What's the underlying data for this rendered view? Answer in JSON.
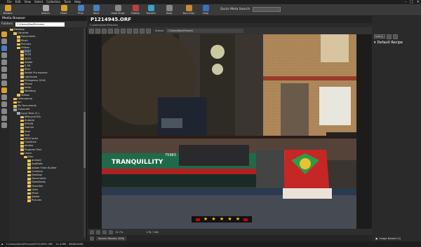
{
  "menubar": {
    "items": [
      "File",
      "Edit",
      "View",
      "Select",
      "Collection",
      "Tools",
      "Help"
    ]
  },
  "toolbar": {
    "buttons": [
      {
        "label": "Browse",
        "color": "#d9a12a"
      },
      {
        "label": "Search",
        "color": "#aaaaaa"
      },
      {
        "label": "Paste",
        "color": "#d9a12a"
      },
      {
        "label": "Prev",
        "color": "#4a7fc0"
      },
      {
        "label": "Next",
        "color": "#4a7fc0"
      },
      {
        "label": "Slide Show",
        "color": "#888888"
      },
      {
        "label": "Publish",
        "color": "#c04040"
      },
      {
        "label": "Transfer",
        "color": "#3aa0d0"
      },
      {
        "label": "Tools",
        "color": "#888888"
      },
      {
        "label": "Burn Disc",
        "color": "#cc8a2a"
      },
      {
        "label": "Help",
        "color": "#3a70c0"
      }
    ],
    "quick_search_label": "Quick Meta Search"
  },
  "left_panel": {
    "title": "Media Browser",
    "tab_label": "Folders",
    "path": "C:\\Users\\Dan\\Pictures\\",
    "tree": [
      {
        "label": "Desktop",
        "indent": 0,
        "drive": false
      },
      {
        "label": "Libraries",
        "indent": 1,
        "drive": false
      },
      {
        "label": "Documents",
        "indent": 2,
        "drive": false
      },
      {
        "label": "Music",
        "indent": 2,
        "drive": false
      },
      {
        "label": "Pictures",
        "indent": 2,
        "drive": false
      },
      {
        "label": "Videos",
        "indent": 2,
        "drive": false
      },
      {
        "label": "2017",
        "indent": 3,
        "drive": false,
        "selected": true
      },
      {
        "label": "2016",
        "indent": 3,
        "drive": false
      },
      {
        "label": "2015",
        "indent": 3,
        "drive": false
      },
      {
        "label": "Adobe",
        "indent": 3,
        "drive": false
      },
      {
        "label": "E-M1",
        "indent": 3,
        "drive": false
      },
      {
        "label": "flickr",
        "indent": 3,
        "drive": false
      },
      {
        "label": "Kodak Pro exports",
        "indent": 3,
        "drive": false
      },
      {
        "label": "Lightroom",
        "indent": 3,
        "drive": false
      },
      {
        "label": "Philippines 2016",
        "indent": 3,
        "drive": false
      },
      {
        "label": "Phone",
        "indent": 3,
        "drive": false
      },
      {
        "label": "temp",
        "indent": 3,
        "drive": false
      },
      {
        "label": "Wedding",
        "indent": 3,
        "drive": false
      },
      {
        "label": "Videos",
        "indent": 2,
        "drive": false
      },
      {
        "label": "Homegroup",
        "indent": 1,
        "drive": false
      },
      {
        "label": "Ian",
        "indent": 1,
        "drive": false
      },
      {
        "label": "My Documents",
        "indent": 1,
        "drive": false
      },
      {
        "label": "Computer",
        "indent": 1,
        "drive": true
      },
      {
        "label": "Local Disk (C:)",
        "indent": 2,
        "drive": true
      },
      {
        "label": "$Recycle.Bin",
        "indent": 3,
        "drive": false
      },
      {
        "label": "Android",
        "indent": 3,
        "drive": false
      },
      {
        "label": "EPSON",
        "indent": 3,
        "drive": false
      },
      {
        "label": "Garmin",
        "indent": 3,
        "drive": false
      },
      {
        "label": "Intel",
        "indent": 3,
        "drive": false
      },
      {
        "label": "logs",
        "indent": 3,
        "drive": false
      },
      {
        "label": "MSOCache",
        "indent": 3,
        "drive": false
      },
      {
        "label": "OneDrive",
        "indent": 3,
        "drive": false
      },
      {
        "label": "photos",
        "indent": 3,
        "drive": false
      },
      {
        "label": "Program Files",
        "indent": 3,
        "drive": false
      },
      {
        "label": "Users",
        "indent": 3,
        "drive": false
      },
      {
        "label": "Dan",
        "indent": 4,
        "drive": false
      },
      {
        "label": "android",
        "indent": 5,
        "drive": false
      },
      {
        "label": "AppData",
        "indent": 5,
        "drive": false
      },
      {
        "label": "Adobe Flash Builder",
        "indent": 5,
        "drive": false
      },
      {
        "label": "Contacts",
        "indent": 5,
        "drive": false
      },
      {
        "label": "Desktop",
        "indent": 5,
        "drive": false
      },
      {
        "label": "Documents",
        "indent": 5,
        "drive": false
      },
      {
        "label": "Downloads",
        "indent": 5,
        "drive": false
      },
      {
        "label": "Favorites",
        "indent": 5,
        "drive": false
      },
      {
        "label": "Links",
        "indent": 5,
        "drive": false
      },
      {
        "label": "Music",
        "indent": 5,
        "drive": false
      },
      {
        "label": "Adobe",
        "indent": 5,
        "drive": false
      },
      {
        "label": "Pictures",
        "indent": 5,
        "drive": false
      }
    ]
  },
  "viewer": {
    "title": "P1214945.ORF",
    "path": "C:\\Users\\Dan\\Pictures\\",
    "history_label": "history",
    "history_path": "C:\\Users\\Dan\\Pictures\\",
    "zoom": "13.7%",
    "count": "178 / 348",
    "rating_stars": 5,
    "search_results_label": "Search Results (346)",
    "boat_name": "TRANQUILLITY",
    "boat_number": "75983"
  },
  "right_panel": {
    "select_label": "Setting",
    "recipe_label": "Default Recipe",
    "bottom_label": "Image Basket (0)"
  },
  "statusbar": {
    "path": "C:\\Users\\Dan\\Pictures\\P1214945.ORF",
    "size": "11.4 MB",
    "dimensions": "4608x3456"
  }
}
